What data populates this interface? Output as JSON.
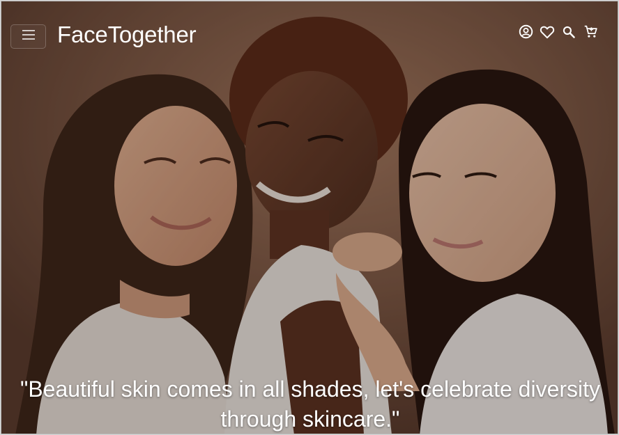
{
  "header": {
    "brand": "FaceTogether",
    "menu_icon": "hamburger-menu-icon",
    "icons": [
      "account-circle-icon",
      "heart-outline-icon",
      "search-icon",
      "shopping-cart-icon"
    ]
  },
  "hero": {
    "image": "three smiling women in white tops",
    "quote": "\"Beautiful skin comes in all shades, let's celebrate diversity through skincare.\""
  },
  "colors": {
    "text": "#ffffff",
    "background_warm": "#8c6650",
    "shirt_white": "#f2ede8"
  }
}
